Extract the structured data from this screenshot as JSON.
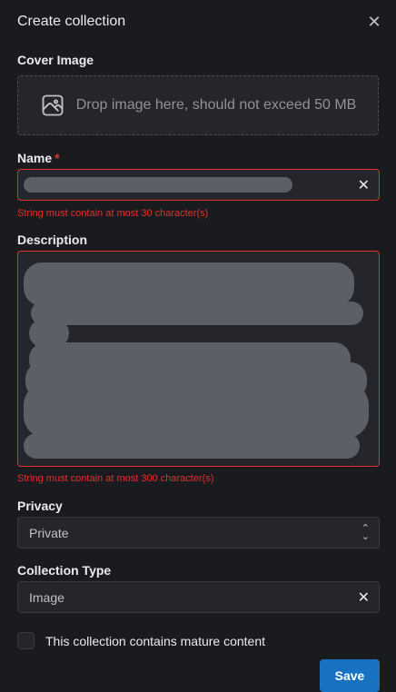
{
  "modal": {
    "title": "Create collection"
  },
  "cover": {
    "label": "Cover Image",
    "drop_text": "Drop image here, should not exceed 50 MB"
  },
  "name": {
    "label": "Name",
    "required_mark": "*",
    "value": "",
    "error": "String must contain at most 30 character(s)"
  },
  "description": {
    "label": "Description",
    "value": "",
    "error": "String must contain at most 300 character(s)"
  },
  "privacy": {
    "label": "Privacy",
    "selected": "Private"
  },
  "collection_type": {
    "label": "Collection Type",
    "selected": "Image"
  },
  "mature": {
    "label": "This collection contains mature content",
    "checked": false
  },
  "actions": {
    "save_label": "Save"
  },
  "colors": {
    "background": "#1a1b1e",
    "input_bg": "#25262b",
    "error": "#e03131",
    "primary": "#1971c2"
  },
  "icons": {
    "close": "close-icon",
    "image": "image-icon",
    "clear": "clear-icon",
    "selector": "chevron-up-down-icon"
  }
}
